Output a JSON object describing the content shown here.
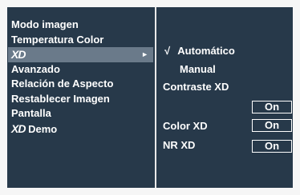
{
  "menu": {
    "items": [
      {
        "label": "Modo imagen"
      },
      {
        "label": "Temperatura Color"
      },
      {
        "label": "XD",
        "arrow": "►"
      },
      {
        "label": "Avanzado"
      },
      {
        "label": "Relación de Aspecto"
      },
      {
        "label": "Restablecer Imagen"
      },
      {
        "label": "Pantalla"
      },
      {
        "label": "Demo",
        "logo": "XD"
      }
    ]
  },
  "submenu": {
    "check": "√",
    "automatic": "Automático",
    "manual": "Manual",
    "contrast_label": "Contraste XD",
    "contrast_value": "On",
    "color_label": "Color XD",
    "color_value": "On",
    "nr_label": "NR XD",
    "nr_value": "On"
  },
  "colors": {
    "background": "#27394a",
    "selected_row": "#6a7a8a",
    "text": "#ffffff",
    "frame": "#f6f6f6"
  }
}
